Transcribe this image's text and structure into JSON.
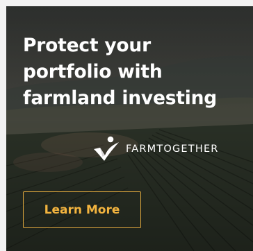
{
  "ad": {
    "headline_lines": [
      "Protect your",
      "portfolio with",
      "farmland investing"
    ],
    "brand_name": "FARMTOGETHER",
    "cta_label": "Learn More"
  },
  "colors": {
    "headline": "#ffffff",
    "cta_border": "#d8a33c",
    "cta_text": "#f3b43f",
    "background": "#2a2f2c"
  },
  "icons": {
    "brand_logo": "farmtogether-checkmark-leaf-logo"
  }
}
